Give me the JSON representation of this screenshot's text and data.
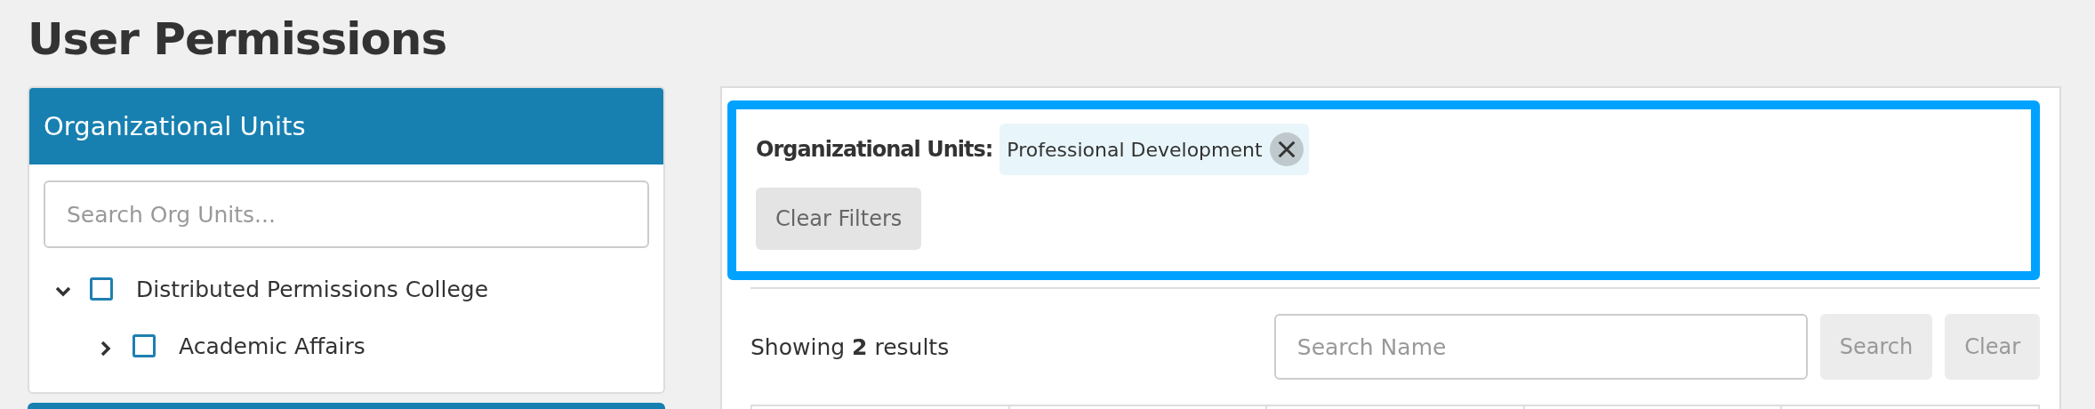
{
  "page_title": "User Permissions",
  "org_units_panel": {
    "title": "Organizational Units",
    "search": {
      "placeholder": "Search Org Units..."
    },
    "tree": [
      {
        "label": "Distributed Permissions College",
        "checked": false,
        "expanded": true,
        "children": [
          {
            "label": "Academic Affairs",
            "checked": false,
            "expanded": false
          }
        ]
      }
    ]
  },
  "filters": {
    "label": "Organizational Units:",
    "chips": [
      {
        "label": "Professional Development"
      }
    ],
    "clear_button": "Clear Filters"
  },
  "results": {
    "summary": "Showing **2** results",
    "search": {
      "placeholder": "Search Name"
    },
    "buttons": [
      "Search",
      "Clear"
    ]
  }
}
